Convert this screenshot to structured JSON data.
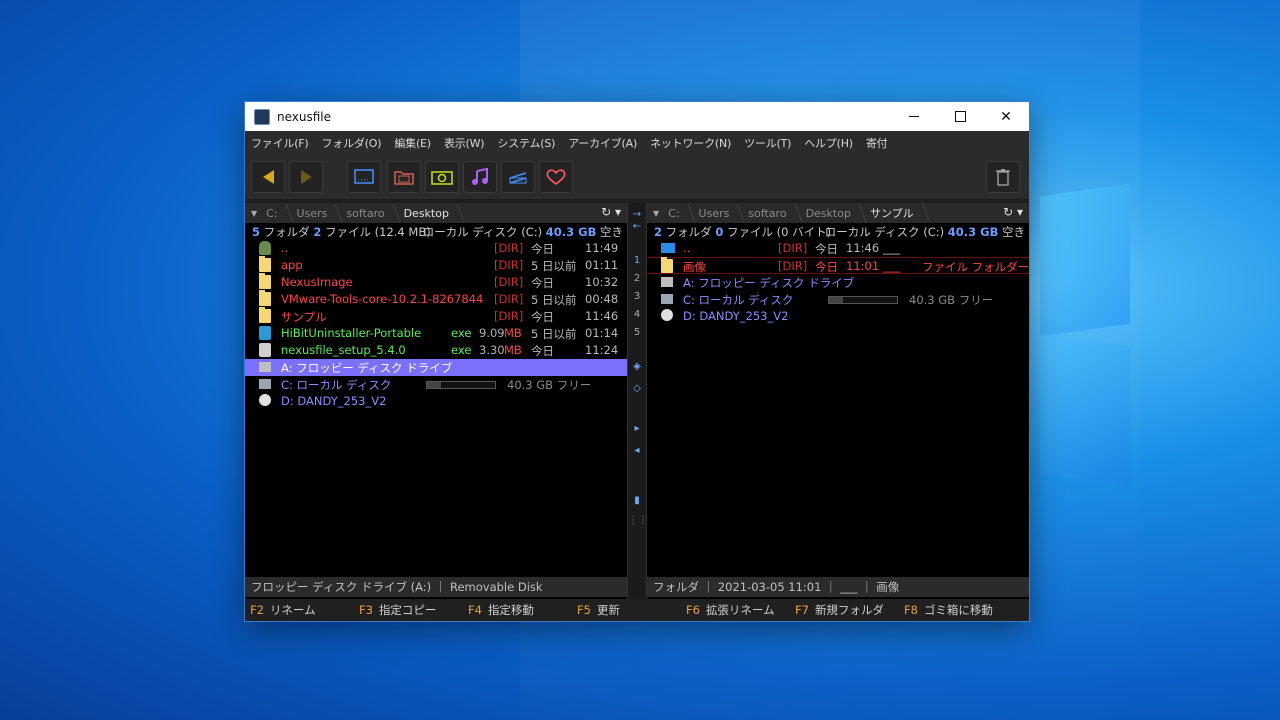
{
  "window": {
    "title": "nexusfile"
  },
  "menu": [
    "ファイル(F)",
    "フォルダ(O)",
    "編集(E)",
    "表示(W)",
    "システム(S)",
    "アーカイブ(A)",
    "ネットワーク(N)",
    "ツール(T)",
    "ヘルプ(H)",
    "寄付"
  ],
  "toolbar": {
    "icons": [
      "back-icon",
      "forward-icon",
      "screen-icon",
      "folder-icon",
      "photo-icon",
      "music-icon",
      "network-icon",
      "favorites-icon",
      "trash-icon"
    ],
    "colors": {
      "back": "#d9a81a",
      "forward": "#6b5a18",
      "photo": "#c8e020",
      "music": "#b060ff",
      "net": "#4090ff",
      "fav": "#ff5a5a"
    }
  },
  "left": {
    "breadcrumb": [
      "C:",
      "Users",
      "softaro",
      "Desktop"
    ],
    "summary": {
      "folders": "5",
      "folders_label": "フォルダ",
      "files": "2",
      "files_label": "ファイル",
      "size": "(12.4 MB)",
      "drive": "ローカル ディスク (C:)",
      "free": "40.3 GB",
      "free_label": "空き"
    },
    "rows": [
      {
        "name": "..",
        "type": "[DIR]",
        "date": "今日",
        "time": "11:49"
      },
      {
        "name": "app",
        "type": "[DIR]",
        "date": "5 日以前",
        "time": "01:11"
      },
      {
        "name": "NexusImage",
        "type": "[DIR]",
        "date": "今日",
        "time": "10:32"
      },
      {
        "name": "VMware-Tools-core-10.2.1-8267844",
        "type": "[DIR]",
        "date": "5 日以前",
        "time": "00:48"
      },
      {
        "name": "サンプル",
        "type": "[DIR]",
        "date": "今日",
        "time": "11:46"
      },
      {
        "name": "HiBitUninstaller-Portable",
        "type": "exe",
        "size": "9.09",
        "unit": "MB",
        "date": "5 日以前",
        "time": "01:14"
      },
      {
        "name": "nexusfile_setup_5.4.0",
        "type": "exe",
        "size": "3.30",
        "unit": "MB",
        "date": "今日",
        "time": "11:24"
      }
    ],
    "drives": [
      {
        "name": "A: フロッピー ディスク ドライブ"
      },
      {
        "name": "C: ローカル ディスク",
        "free": "40.3 GB フリー",
        "used_fraction": 0.2
      },
      {
        "name": "D: DANDY_253_V2"
      }
    ],
    "status": "フロッピー ディスク ドライブ (A:) ｜ Removable Disk"
  },
  "right": {
    "breadcrumb": [
      "C:",
      "Users",
      "softaro",
      "Desktop",
      "サンプル"
    ],
    "summary": {
      "folders": "2",
      "folders_label": "フォルダ",
      "files": "0",
      "files_label": "ファイル",
      "size": "(0 バイト)",
      "drive": "ローカル ディスク (C:)",
      "free": "40.3 GB",
      "free_label": "空き"
    },
    "rows": [
      {
        "name": "..",
        "type": "[DIR]",
        "date": "今日",
        "time": "11:46",
        "attr": "___"
      },
      {
        "name": "画像",
        "type": "[DIR]",
        "date": "今日",
        "time": "11:01",
        "attr": "___",
        "kind": "ファイル フォルダー"
      }
    ],
    "drives": [
      {
        "name": "A: フロッピー ディスク ドライブ"
      },
      {
        "name": "C: ローカル ディスク",
        "free": "40.3 GB フリー",
        "used_fraction": 0.2
      },
      {
        "name": "D: DANDY_253_V2"
      }
    ],
    "status": "フォルダ ｜ 2021-03-05 11:01 ｜ ___ ｜ 画像"
  },
  "divider": {
    "numbers": [
      "1",
      "2",
      "3",
      "4",
      "5"
    ]
  },
  "fkeys": [
    {
      "key": "F2",
      "label": "リネーム"
    },
    {
      "key": "F3",
      "label": "指定コピー"
    },
    {
      "key": "F4",
      "label": "指定移動"
    },
    {
      "key": "F5",
      "label": "更新"
    },
    {
      "key": "F6",
      "label": "拡張リネーム"
    },
    {
      "key": "F7",
      "label": "新規フォルダ"
    },
    {
      "key": "F8",
      "label": "ゴミ箱に移動"
    }
  ]
}
